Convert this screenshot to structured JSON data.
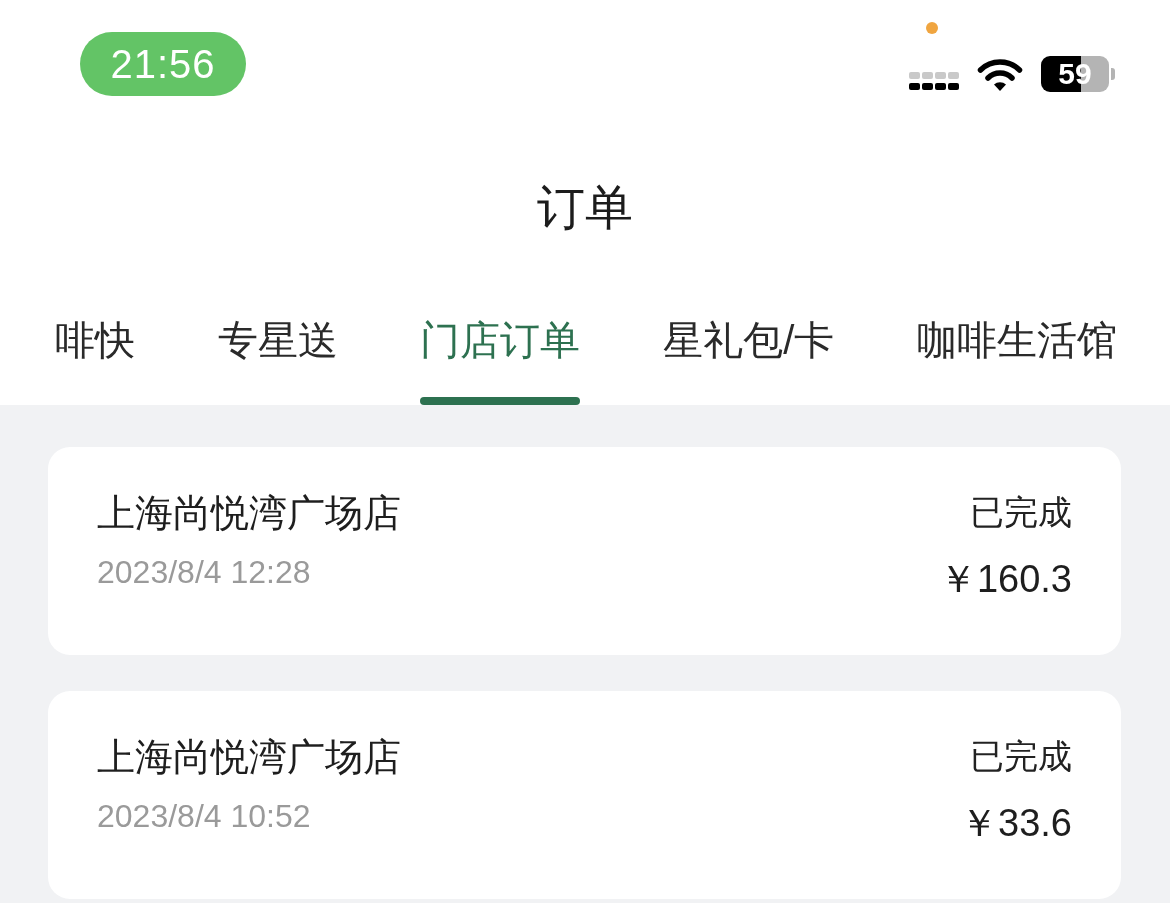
{
  "status_bar": {
    "time": "21:56",
    "battery": "59"
  },
  "header": {
    "title": "订单"
  },
  "tabs": [
    {
      "label": "啡快",
      "selected": false
    },
    {
      "label": "专星送",
      "selected": false
    },
    {
      "label": "门店订单",
      "selected": true
    },
    {
      "label": "星礼包/卡",
      "selected": false
    },
    {
      "label": "咖啡生活馆",
      "selected": false
    }
  ],
  "orders": [
    {
      "store": "上海尚悦湾广场店",
      "datetime": "2023/8/4 12:28",
      "status": "已完成",
      "price": "￥160.3"
    },
    {
      "store": "上海尚悦湾广场店",
      "datetime": "2023/8/4 10:52",
      "status": "已完成",
      "price": "￥33.6"
    }
  ]
}
